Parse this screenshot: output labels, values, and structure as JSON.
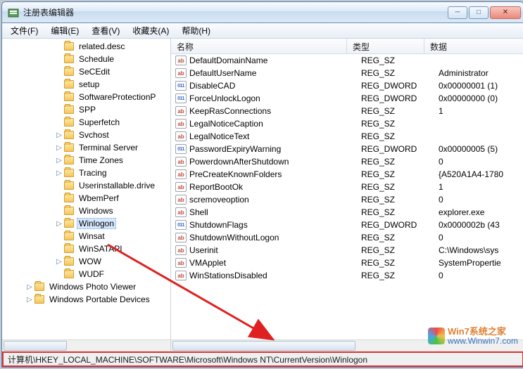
{
  "window": {
    "title": "注册表编辑器",
    "min": "─",
    "max": "□",
    "close": "✕"
  },
  "menu": {
    "file": "文件(F)",
    "edit": "编辑(E)",
    "view": "查看(V)",
    "fav": "收藏夹(A)",
    "help": "帮助(H)"
  },
  "tree": {
    "items": [
      {
        "indent": 5,
        "exp": "",
        "label": "related.desc"
      },
      {
        "indent": 5,
        "exp": "",
        "label": "Schedule"
      },
      {
        "indent": 5,
        "exp": "",
        "label": "SeCEdit"
      },
      {
        "indent": 5,
        "exp": "",
        "label": "setup"
      },
      {
        "indent": 5,
        "exp": "",
        "label": "SoftwareProtectionP"
      },
      {
        "indent": 5,
        "exp": "",
        "label": "SPP"
      },
      {
        "indent": 5,
        "exp": "",
        "label": "Superfetch"
      },
      {
        "indent": 5,
        "exp": "▷",
        "label": "Svchost"
      },
      {
        "indent": 5,
        "exp": "▷",
        "label": "Terminal Server"
      },
      {
        "indent": 5,
        "exp": "▷",
        "label": "Time Zones"
      },
      {
        "indent": 5,
        "exp": "▷",
        "label": "Tracing"
      },
      {
        "indent": 5,
        "exp": "",
        "label": "Userinstallable.drive"
      },
      {
        "indent": 5,
        "exp": "",
        "label": "WbemPerf"
      },
      {
        "indent": 5,
        "exp": "",
        "label": "Windows"
      },
      {
        "indent": 5,
        "exp": "▷",
        "label": "Winlogon",
        "sel": true
      },
      {
        "indent": 5,
        "exp": "",
        "label": "Winsat"
      },
      {
        "indent": 5,
        "exp": "",
        "label": "WinSATAPI"
      },
      {
        "indent": 5,
        "exp": "▷",
        "label": "WOW"
      },
      {
        "indent": 5,
        "exp": "",
        "label": "WUDF"
      },
      {
        "indent": 2,
        "exp": "▷",
        "label": "Windows Photo Viewer"
      },
      {
        "indent": 2,
        "exp": "▷",
        "label": "Windows Portable Devices"
      }
    ]
  },
  "list": {
    "cols": {
      "name": "名称",
      "type": "类型",
      "data": "数据"
    },
    "rows": [
      {
        "icon": "sz",
        "name": "DefaultDomainName",
        "type": "REG_SZ",
        "data": ""
      },
      {
        "icon": "sz",
        "name": "DefaultUserName",
        "type": "REG_SZ",
        "data": "Administrator"
      },
      {
        "icon": "dw",
        "name": "DisableCAD",
        "type": "REG_DWORD",
        "data": "0x00000001 (1)"
      },
      {
        "icon": "dw",
        "name": "ForceUnlockLogon",
        "type": "REG_DWORD",
        "data": "0x00000000 (0)"
      },
      {
        "icon": "sz",
        "name": "KeepRasConnections",
        "type": "REG_SZ",
        "data": "1"
      },
      {
        "icon": "sz",
        "name": "LegalNoticeCaption",
        "type": "REG_SZ",
        "data": ""
      },
      {
        "icon": "sz",
        "name": "LegalNoticeText",
        "type": "REG_SZ",
        "data": ""
      },
      {
        "icon": "dw",
        "name": "PasswordExpiryWarning",
        "type": "REG_DWORD",
        "data": "0x00000005 (5)"
      },
      {
        "icon": "sz",
        "name": "PowerdownAfterShutdown",
        "type": "REG_SZ",
        "data": "0"
      },
      {
        "icon": "sz",
        "name": "PreCreateKnownFolders",
        "type": "REG_SZ",
        "data": "{A520A1A4-1780"
      },
      {
        "icon": "sz",
        "name": "ReportBootOk",
        "type": "REG_SZ",
        "data": "1"
      },
      {
        "icon": "sz",
        "name": "scremoveoption",
        "type": "REG_SZ",
        "data": "0"
      },
      {
        "icon": "sz",
        "name": "Shell",
        "type": "REG_SZ",
        "data": "explorer.exe"
      },
      {
        "icon": "dw",
        "name": "ShutdownFlags",
        "type": "REG_DWORD",
        "data": "0x0000002b (43"
      },
      {
        "icon": "sz",
        "name": "ShutdownWithoutLogon",
        "type": "REG_SZ",
        "data": "0"
      },
      {
        "icon": "sz",
        "name": "Userinit",
        "type": "REG_SZ",
        "data": "C:\\Windows\\sys"
      },
      {
        "icon": "sz",
        "name": "VMApplet",
        "type": "REG_SZ",
        "data": "SystemPropertie"
      },
      {
        "icon": "sz",
        "name": "WinStationsDisabled",
        "type": "REG_SZ",
        "data": "0"
      }
    ]
  },
  "statusbar": {
    "path": "计算机\\HKEY_LOCAL_MACHINE\\SOFTWARE\\Microsoft\\Windows NT\\CurrentVersion\\Winlogon"
  },
  "watermark": {
    "line1": "Win7系统之家",
    "line2": "www.Winwin7.com"
  }
}
